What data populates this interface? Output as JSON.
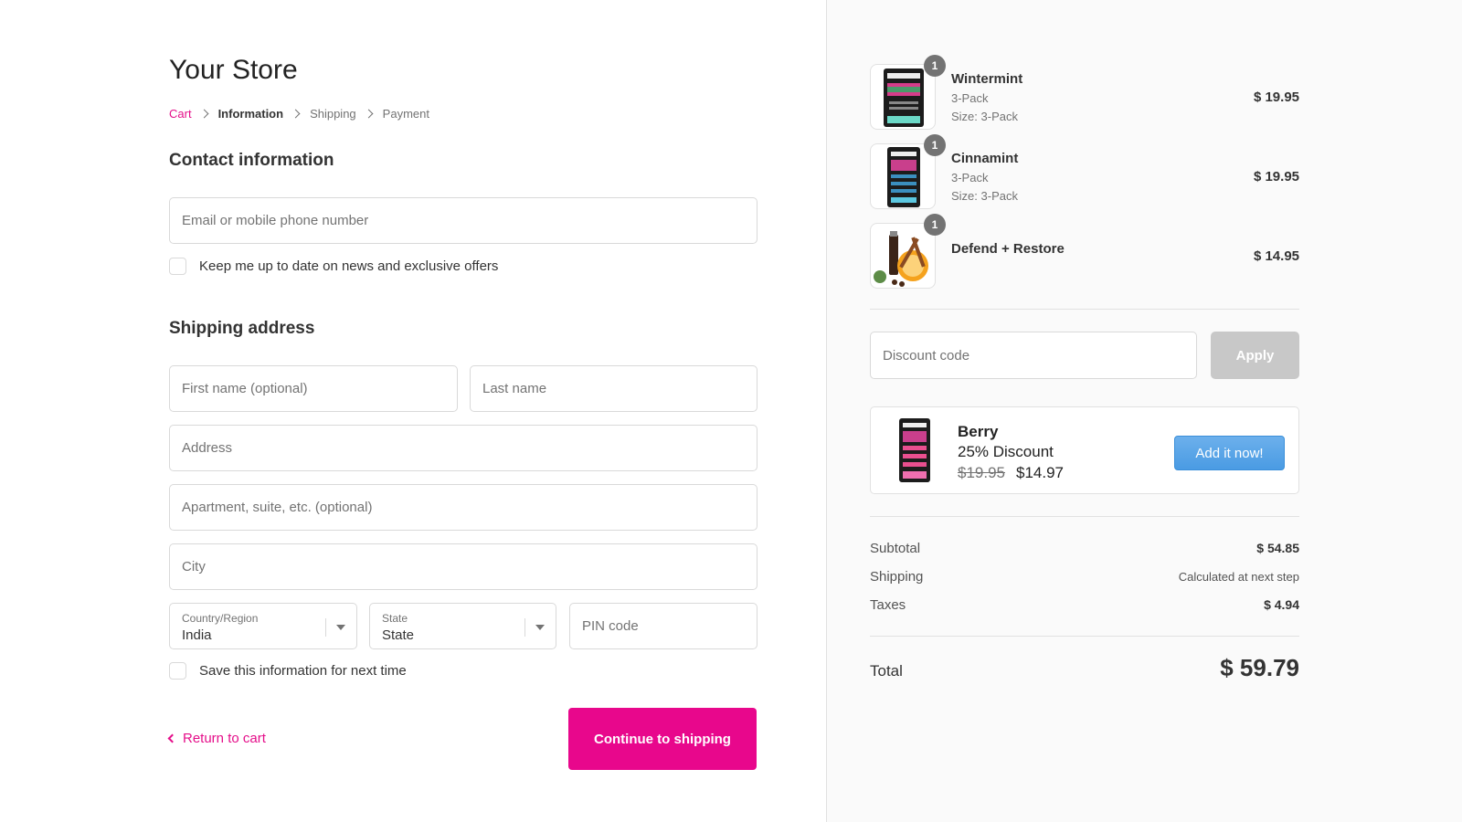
{
  "store": {
    "title": "Your Store"
  },
  "breadcrumb": {
    "cart": "Cart",
    "information": "Information",
    "shipping": "Shipping",
    "payment": "Payment"
  },
  "contact": {
    "title": "Contact information",
    "email_placeholder": "Email or mobile phone number",
    "newsletter_label": "Keep me up to date on news and exclusive offers"
  },
  "shipping_address": {
    "title": "Shipping address",
    "first_name_placeholder": "First name (optional)",
    "last_name_placeholder": "Last name",
    "address_placeholder": "Address",
    "apartment_placeholder": "Apartment, suite, etc. (optional)",
    "city_placeholder": "City",
    "country_label": "Country/Region",
    "country_value": "India",
    "state_label": "State",
    "state_value": "State",
    "pin_placeholder": "PIN code",
    "save_label": "Save this information for next time"
  },
  "actions": {
    "return_label": "Return to cart",
    "continue_label": "Continue to shipping"
  },
  "order": {
    "items": [
      {
        "name": "Wintermint",
        "variant": "3-Pack",
        "size": "Size: 3-Pack",
        "price": "$ 19.95",
        "qty": "1"
      },
      {
        "name": "Cinnamint",
        "variant": "3-Pack",
        "size": "Size: 3-Pack",
        "price": "$ 19.95",
        "qty": "1"
      },
      {
        "name": "Defend + Restore",
        "price": "$ 14.95",
        "qty": "1"
      }
    ],
    "discount_placeholder": "Discount code",
    "apply_label": "Apply",
    "upsell": {
      "name": "Berry",
      "discount": "25% Discount",
      "old_price": "$19.95",
      "new_price": "$14.97",
      "button": "Add it now!"
    },
    "subtotal_label": "Subtotal",
    "subtotal_value": "$ 54.85",
    "shipping_label": "Shipping",
    "shipping_value": "Calculated at next step",
    "taxes_label": "Taxes",
    "taxes_value": "$ 4.94",
    "total_label": "Total",
    "total_value": "$ 59.79"
  },
  "colors": {
    "accent": "#e8078c",
    "link": "#e50f8a",
    "upsell_button": "#4a9be3",
    "sidebar_bg": "#fafafa"
  }
}
